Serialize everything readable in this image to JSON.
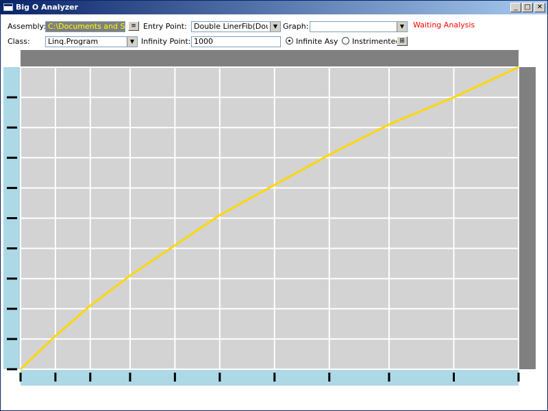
{
  "window": {
    "title": "Big O Analyzer",
    "min_glyph": "_",
    "max_glyph": "□",
    "close_glyph": "✕"
  },
  "toolbar": {
    "assembly_label": "Assembly:",
    "assembly_value": "C:\\Documents and Settings",
    "browse_glyph": "≡",
    "entry_label": "Entry Point:",
    "entry_value": "Double LinerFib(Double)",
    "graph_label": "Graph:",
    "graph_value": "",
    "status": "Waiting Analysis",
    "class_label": "Class:",
    "class_value": "Linq.Program",
    "infinity_label": "Infinity Point:",
    "infinity_value": "1000",
    "radio_infinite_label": "Infinite Asy",
    "radio_instrumented_label": "Instrimented",
    "settings_glyph": "⊞"
  },
  "colors": {
    "plot_bg": "#d3d3d3",
    "axis_bg": "#add8e6",
    "header_bg": "#808080",
    "curve": "#ffd700",
    "status": "#ff0000"
  },
  "chart_data": {
    "type": "line",
    "title": "",
    "xlabel": "",
    "ylabel": "",
    "x_tick_count": 11,
    "y_tick_count": 10,
    "grid": true,
    "xlim": [
      0,
      1
    ],
    "ylim": [
      0,
      1
    ],
    "series": [
      {
        "x": [
          0,
          0.07,
          0.14,
          0.22,
          0.31,
          0.4,
          0.51,
          0.62,
          0.74,
          0.87,
          1.0
        ],
        "y": [
          0,
          0.11,
          0.21,
          0.31,
          0.41,
          0.51,
          0.61,
          0.71,
          0.81,
          0.9,
          1.0
        ]
      }
    ]
  }
}
